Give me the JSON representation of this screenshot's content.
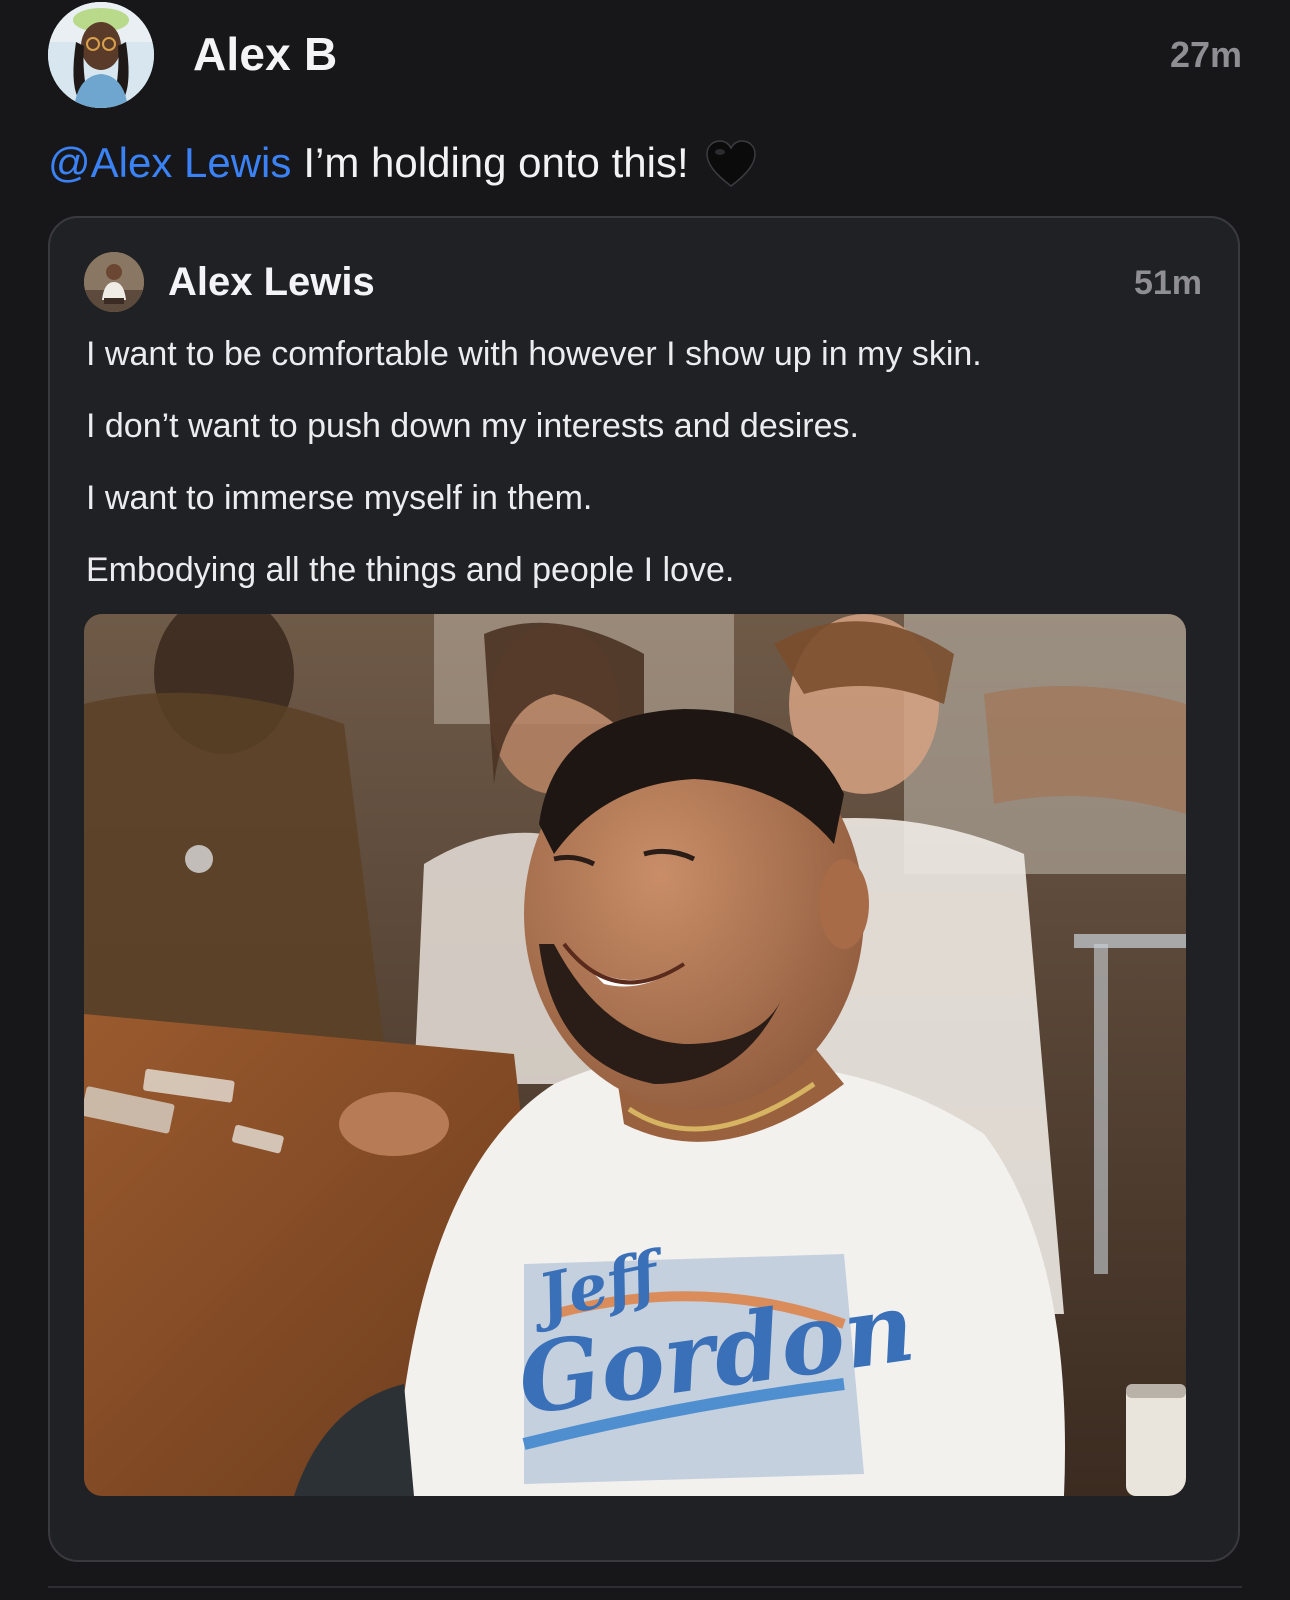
{
  "post": {
    "author": "Alex B",
    "time": "27m",
    "mention": "@Alex Lewis",
    "text": "I’m holding onto this!",
    "emoji": "black-heart"
  },
  "quoted_post": {
    "author": "Alex Lewis",
    "time": "51m",
    "lines": [
      "I want to be comfortable with however I show up in my skin.",
      "I don’t want to push down my interests and desires.",
      "I want to immerse myself in them.",
      "Embodying all the things and people I love."
    ],
    "photo": {
      "shirt_print_line1": "Jeff",
      "shirt_print_line2": "Gordon"
    }
  },
  "colors": {
    "background": "#17171a",
    "card": "#202124",
    "mention": "#3b82f6",
    "muted": "#8e8e93"
  }
}
